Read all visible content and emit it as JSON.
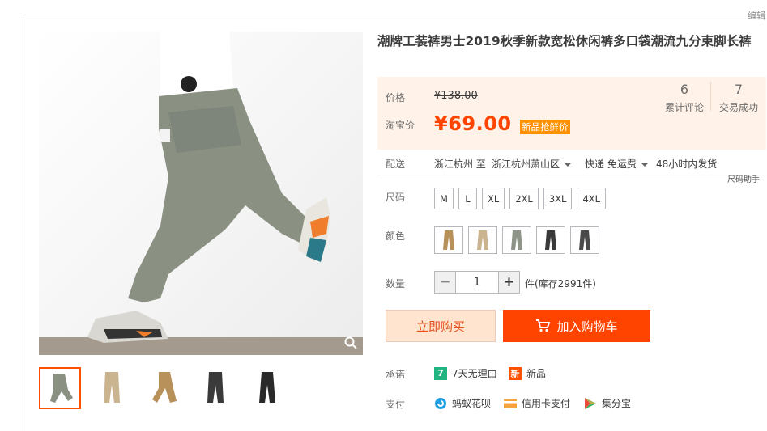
{
  "edit_link": "编辑",
  "product": {
    "title": "潮牌工装裤男士2019秋季新款宽松休闲裤多口袋潮流九分束脚长裤"
  },
  "price": {
    "label_price": "价格",
    "original": "¥138.00",
    "label_taobao": "淘宝价",
    "current": "¥69.00",
    "badge": "新品抢鲜价"
  },
  "stats": {
    "reviews_count": "6",
    "reviews_label": "累计评论",
    "trades_count": "7",
    "trades_label": "交易成功"
  },
  "shipping": {
    "label": "配送",
    "from": "浙江杭州 至",
    "to": "浙江杭州萧山区",
    "method": "快递 免运费",
    "dispatch": "48小时内发货"
  },
  "size_helper": "尺码助手",
  "size": {
    "label": "尺码",
    "options": [
      "M",
      "L",
      "XL",
      "2XL",
      "3XL",
      "4XL"
    ]
  },
  "color": {
    "label": "颜色",
    "swatches": [
      "#b8915a",
      "#c9b48f",
      "#8e9488",
      "#3a3a3a",
      "#4a4a4a"
    ]
  },
  "quantity": {
    "label": "数量",
    "minus": "−",
    "value": "1",
    "plus": "+",
    "stock": "件(库存2991件)"
  },
  "buttons": {
    "buy_now": "立即购买",
    "add_cart": "加入购物车"
  },
  "promise": {
    "label": "承诺",
    "item1_icon": "7",
    "item1": "7天无理由",
    "item2_icon": "新",
    "item2": "新品"
  },
  "payment": {
    "label": "支付",
    "item1": "蚂蚁花呗",
    "item2": "信用卡支付",
    "item3": "集分宝"
  },
  "colors": {
    "accent": "#ff4400",
    "badge": "#ff9000",
    "price_bg": "#fff2e8"
  }
}
